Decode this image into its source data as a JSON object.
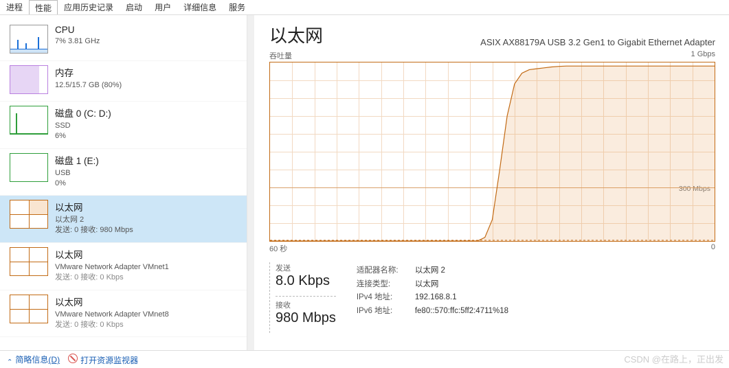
{
  "tabs": {
    "items": [
      "进程",
      "性能",
      "应用历史记录",
      "启动",
      "用户",
      "详细信息",
      "服务"
    ],
    "active_index": 1
  },
  "sidebar": {
    "items": [
      {
        "title": "CPU",
        "line1": "7% 3.81 GHz",
        "line2": ""
      },
      {
        "title": "内存",
        "line1": "12.5/15.7 GB (80%)",
        "line2": ""
      },
      {
        "title": "磁盘 0 (C: D:)",
        "line1": "SSD",
        "line2": "6%"
      },
      {
        "title": "磁盘 1 (E:)",
        "line1": "USB",
        "line2": "0%"
      },
      {
        "title": "以太网",
        "line1": "以太网 2",
        "line2": "发送: 0 接收: 980 Mbps",
        "selected": true
      },
      {
        "title": "以太网",
        "line1": "VMware Network Adapter VMnet1",
        "line2": "发送: 0 接收: 0 Kbps"
      },
      {
        "title": "以太网",
        "line1": "VMware Network Adapter VMnet8",
        "line2": "发送: 0 接收: 0 Kbps"
      }
    ]
  },
  "main": {
    "title": "以太网",
    "adapter": "ASIX AX88179A USB 3.2 Gen1 to Gigabit Ethernet Adapter",
    "chart_top_left": "吞吐量",
    "chart_top_right": "1 Gbps",
    "chart_bottom_left": "60 秒",
    "chart_bottom_right": "0",
    "y_tick": "300 Mbps",
    "send_label": "发送",
    "send_value": "8.0 Kbps",
    "recv_label": "接收",
    "recv_value": "980 Mbps",
    "info": {
      "adapter_name_k": "适配器名称:",
      "adapter_name_v": "以太网 2",
      "conn_type_k": "连接类型:",
      "conn_type_v": "以太网",
      "ipv4_k": "IPv4 地址:",
      "ipv4_v": "192.168.8.1",
      "ipv6_k": "IPv6 地址:",
      "ipv6_v": "fe80::570:ffc:5ff2:4711%18"
    }
  },
  "footer": {
    "fewer": "简略信息",
    "fewer_u": "(D)",
    "open_monitor": "打开资源监视器"
  },
  "watermark": "CSDN @在路上，正出发",
  "chart_data": {
    "type": "line",
    "title": "吞吐量",
    "xlabel": "60 秒 → 0",
    "ylabel": "吞吐量",
    "ylim": [
      0,
      1000
    ],
    "y_unit": "Mbps",
    "x_seconds_ago": [
      60,
      57,
      54,
      51,
      48,
      45,
      42,
      39,
      36,
      33,
      32,
      31,
      30,
      29,
      28,
      27,
      26,
      25,
      24,
      23,
      22,
      21,
      20,
      19,
      18,
      15,
      12,
      9,
      6,
      3,
      0
    ],
    "series": [
      {
        "name": "发送",
        "values_mbps": [
          0,
          0,
          0,
          0,
          0,
          0,
          0,
          0,
          0,
          0,
          0,
          0,
          0,
          0,
          0,
          0,
          0,
          0,
          0,
          0,
          0,
          0,
          0,
          0,
          0,
          0,
          0,
          0,
          0,
          0,
          0
        ]
      },
      {
        "name": "接收",
        "values_mbps": [
          0,
          0,
          0,
          0,
          0,
          0,
          0,
          0,
          0,
          0,
          0,
          20,
          120,
          400,
          700,
          880,
          940,
          960,
          965,
          970,
          975,
          978,
          980,
          980,
          980,
          980,
          980,
          980,
          980,
          980,
          980
        ]
      }
    ]
  }
}
